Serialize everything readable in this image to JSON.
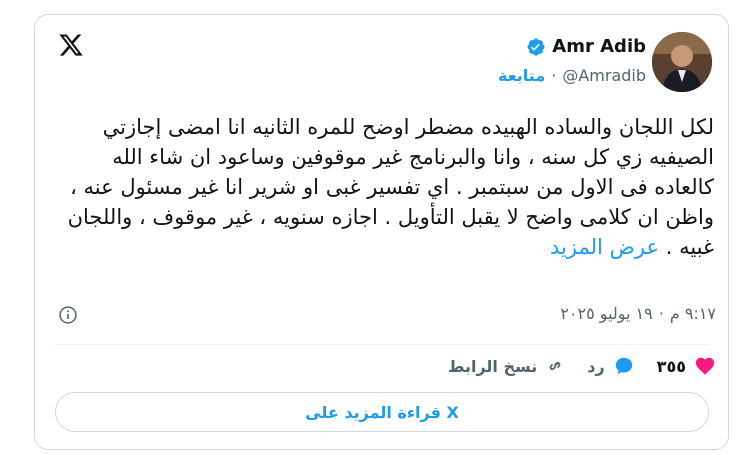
{
  "author": {
    "name": "Amr Adib",
    "handle": "@Amradib",
    "separator": "·",
    "follow_label": "متابعة"
  },
  "tweet": {
    "text": "لكل اللجان والساده الهبيده مضطر اوضح للمره الثانيه انا امضى إجازتي الصيفيه زي كل سنه ، وانا والبرنامج غير موقوفين وساعود ان شاء الله كالعاده فى الاول من سبتمبر . اي تفسير غبى او شرير انا غير مسئول عنه ، واظن ان كلامى واضح لا يقبل التأويل . اجازه سنويه ، غير موقوف ، واللجان غبيه .",
    "show_more": "عرض المزيد"
  },
  "timestamp": {
    "time": "٩:١٧ م",
    "separator": "·",
    "date": "١٩ يوليو ٢٠٢٥"
  },
  "actions": {
    "like_count": "٣٥٥",
    "reply_label": "رد",
    "copy_link_label": "نسخ الرابط"
  },
  "read_more_button": "قراءة المزيد على X",
  "colors": {
    "accent": "#1d9bf0",
    "like": "#f91880",
    "text": "#0f1419",
    "muted": "#536471"
  },
  "icons": [
    "x-logo-icon",
    "verified-badge-icon",
    "info-icon",
    "heart-icon",
    "reply-bubble-icon",
    "link-icon"
  ]
}
